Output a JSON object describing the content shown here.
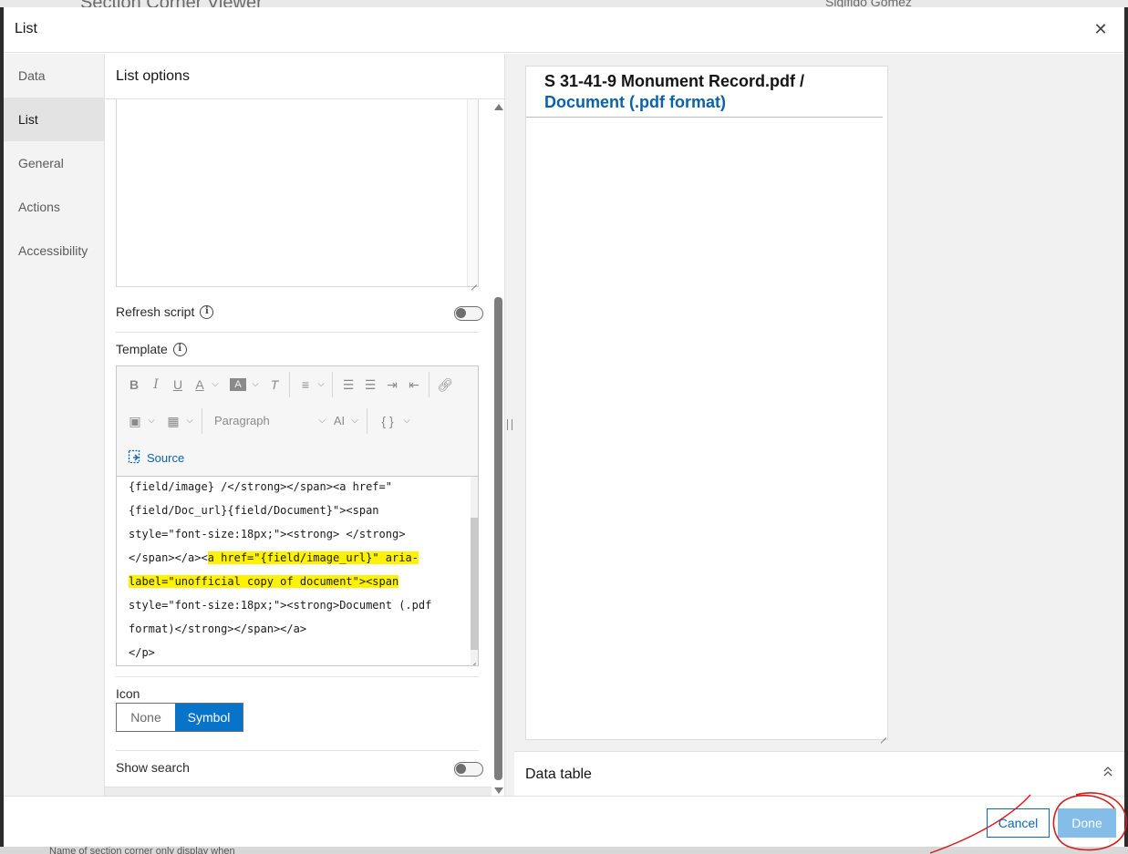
{
  "background": {
    "title": "Section Corner Viewer",
    "user": "Sigifido Gomez",
    "bottom_text": "Name of section corner only display when"
  },
  "dialog": {
    "title": "List",
    "close_icon": "close-icon"
  },
  "nav": {
    "items": [
      {
        "label": "Data",
        "active": false
      },
      {
        "label": "List",
        "active": true
      },
      {
        "label": "General",
        "active": false
      },
      {
        "label": "Actions",
        "active": false
      },
      {
        "label": "Accessibility",
        "active": false
      }
    ]
  },
  "panel": {
    "title": "List options",
    "refresh_script_label": "Refresh script",
    "refresh_script_on": false,
    "template_label": "Template",
    "icon_label": "Icon",
    "icon_options": [
      "None",
      "Symbol"
    ],
    "icon_selected": "Symbol",
    "show_search_label": "Show search",
    "show_search_on": false
  },
  "editor": {
    "toolbar": {
      "bold": "B",
      "italic": "I",
      "underline": "U",
      "font_color": "A",
      "bg_color": "A",
      "clear_format": "T",
      "paragraph": "Paragraph",
      "ai": "AI",
      "fields": "{ }",
      "source": "Source"
    },
    "code_lines": [
      "{field/image} /</strong></span><a href=\"",
      "{field/Doc_url}{field/Document}\"><span",
      "style=\"font-size:18px;\"><strong> </strong>",
      "</span></a><a href=\"{field/image_url}\" aria-",
      "label=\"unofficial copy of document\"><span",
      "style=\"font-size:18px;\"><strong>Document (.pdf",
      "format)</strong></span></a>",
      "</p>"
    ]
  },
  "preview": {
    "title_main": "S 31-41-9 Monument Record.pdf /",
    "title_link": "Document (.pdf format)",
    "link_color": "#0b62a8"
  },
  "data_table": {
    "label": "Data table"
  },
  "footer": {
    "cancel_label": "Cancel",
    "done_label": "Done"
  },
  "colors": {
    "accent": "#0874c9",
    "done_disabled": "#84bde7",
    "highlight": "#fff200",
    "annotation": "#d41c1c"
  }
}
